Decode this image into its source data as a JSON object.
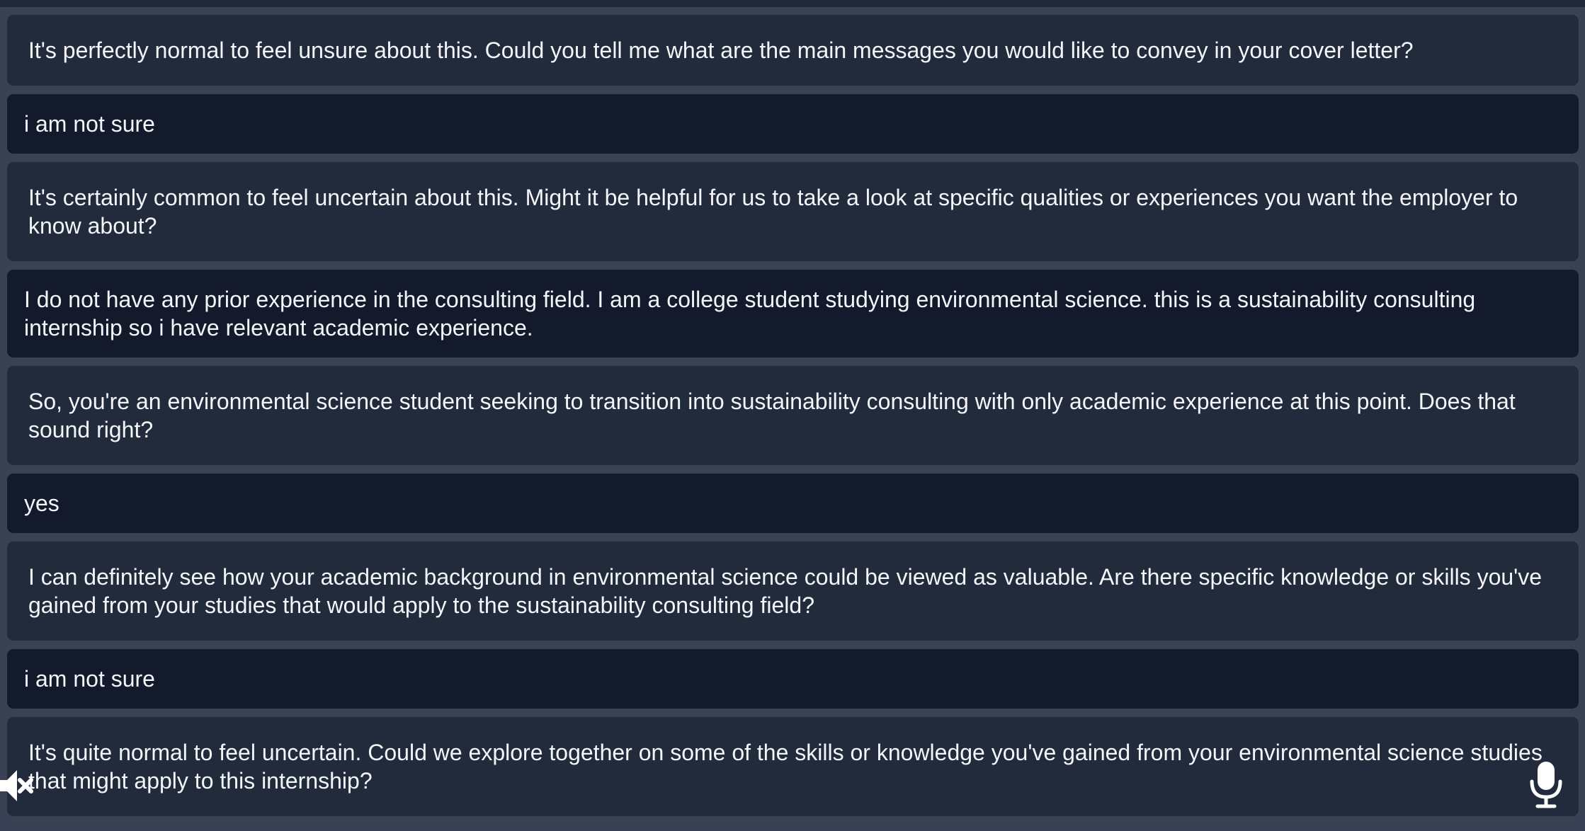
{
  "messages": [
    {
      "role": "assistant",
      "text": "It's perfectly normal to feel unsure about this. Could you tell me what are the main messages you would like to convey in your cover letter?"
    },
    {
      "role": "user",
      "text": "i am not sure"
    },
    {
      "role": "assistant",
      "text": "It's certainly common to feel uncertain about this. Might it be helpful for us to take a look at specific qualities or experiences you want the employer to know about?"
    },
    {
      "role": "user",
      "text": "I do not have any prior experience in the consulting field. I am a college student studying environmental science. this is a sustainability consulting internship so i have relevant academic experience."
    },
    {
      "role": "assistant",
      "text": "So, you're an environmental science student seeking to transition into sustainability consulting with only academic experience at this point. Does that sound right?"
    },
    {
      "role": "user",
      "text": "yes"
    },
    {
      "role": "assistant",
      "text": "I can definitely see how your academic background in environmental science could be viewed as valuable. Are there specific knowledge or skills you've gained from your studies that would apply to the sustainability consulting field?"
    },
    {
      "role": "user",
      "text": "i am not sure"
    },
    {
      "role": "assistant",
      "text": "It's quite normal to feel uncertain. Could we explore together on some of the skills or knowledge you've gained from your environmental science studies that might apply to this internship?"
    }
  ],
  "controls": {
    "mute_icon": "speaker-muted-icon",
    "mic_icon": "microphone-icon"
  },
  "colors": {
    "page_background": "#384254",
    "assistant_bubble": "#222b3c",
    "user_bubble": "#121a2b",
    "text": "#f3f5f8"
  }
}
